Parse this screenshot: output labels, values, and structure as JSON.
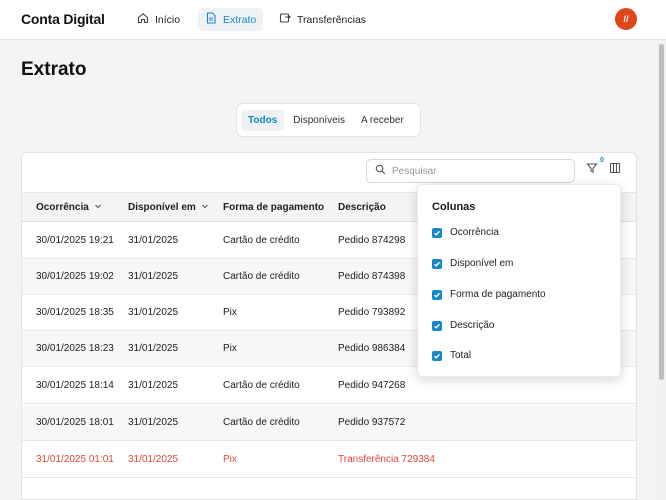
{
  "app": {
    "brand": "Conta Digital",
    "avatar_text": "//"
  },
  "nav": [
    {
      "label": "Início",
      "icon": "home-icon",
      "active": false
    },
    {
      "label": "Extrato",
      "icon": "document-icon",
      "active": true
    },
    {
      "label": "Transferências",
      "icon": "transfer-icon",
      "active": false
    }
  ],
  "page": {
    "title": "Extrato"
  },
  "tabs": [
    {
      "label": "Todos",
      "active": true
    },
    {
      "label": "Disponíveis",
      "active": false
    },
    {
      "label": "A receber",
      "active": false
    }
  ],
  "toolbar": {
    "search_placeholder": "Pesquisar",
    "search_value": "",
    "filter_count": "0"
  },
  "table": {
    "columns": [
      "Ocorrência",
      "Disponível em",
      "Forma de pagamento",
      "Descrição"
    ],
    "rows": [
      {
        "ocorrencia": "30/01/2025 19:21",
        "disponivel": "31/01/2025",
        "pagamento": "Cartão de crédito",
        "descricao": "Pedido 874298"
      },
      {
        "ocorrencia": "30/01/2025 19:02",
        "disponivel": "31/01/2025",
        "pagamento": "Cartão de crédito",
        "descricao": "Pedido 874398"
      },
      {
        "ocorrencia": "30/01/2025 18:35",
        "disponivel": "31/01/2025",
        "pagamento": "Pix",
        "descricao": "Pedido 793892"
      },
      {
        "ocorrencia": "30/01/2025 18:23",
        "disponivel": "31/01/2025",
        "pagamento": "Pix",
        "descricao": "Pedido 986384"
      },
      {
        "ocorrencia": "30/01/2025 18:14",
        "disponivel": "31/01/2025",
        "pagamento": "Cartão de crédito",
        "descricao": "Pedido 947268"
      },
      {
        "ocorrencia": "30/01/2025 18:01",
        "disponivel": "31/01/2025",
        "pagamento": "Cartão de crédito",
        "descricao": "Pedido 937572"
      },
      {
        "ocorrencia": "31/01/2025 01:01",
        "disponivel": "31/01/2025",
        "pagamento": "Pix",
        "descricao": "Transferência 729384"
      }
    ]
  },
  "columns_menu": {
    "title": "Colunas",
    "options": [
      {
        "label": "Ocorrência",
        "checked": true
      },
      {
        "label": "Disponível em",
        "checked": true
      },
      {
        "label": "Forma de pagamento",
        "checked": true
      },
      {
        "label": "Descrição",
        "checked": true
      },
      {
        "label": "Total",
        "checked": true
      }
    ]
  },
  "colors": {
    "accent": "#1488c8",
    "negative": "#e1453b",
    "avatar": "#e1451c"
  }
}
